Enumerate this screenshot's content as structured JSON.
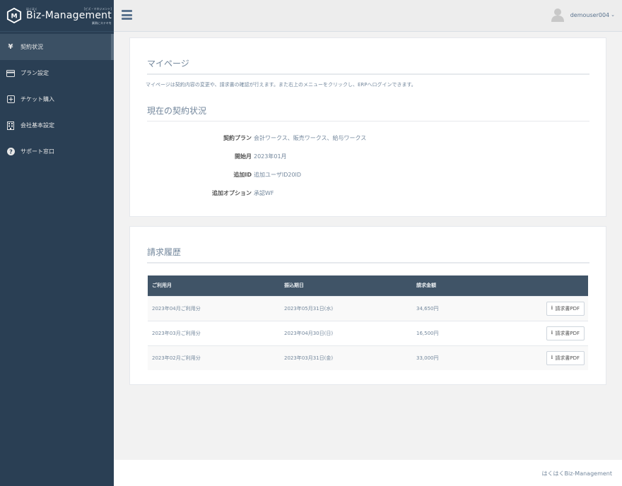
{
  "brand": {
    "sup_left": "はくはく",
    "sup_right": "[ビズ・マネジメント]",
    "name": "Biz-Management",
    "sub": "業務にステキを"
  },
  "sidebar": {
    "items": [
      {
        "icon": "yen-icon",
        "label": "契約状況",
        "active": true
      },
      {
        "icon": "credit-card-icon",
        "label": "プラン設定",
        "active": false
      },
      {
        "icon": "plus-square-icon",
        "label": "チケット購入",
        "active": false
      },
      {
        "icon": "building-icon",
        "label": "会社基本設定",
        "active": false
      },
      {
        "icon": "question-circle-icon",
        "label": "サポート窓口",
        "active": false
      }
    ]
  },
  "topbar": {
    "username": "demouser004",
    "caret": "⌄"
  },
  "mypage": {
    "title": "マイページ",
    "intro": "マイページは契約内容の変更や、請求書の確認が行えます。また右上のメニューをクリックし、ERPへログインできます。",
    "status_title": "現在の契約状況",
    "rows": [
      {
        "key": "契約プラン",
        "value": "会計ワークス、販売ワークス、給与ワークス"
      },
      {
        "key": "開始月",
        "value": "2023年01月"
      },
      {
        "key": "追加ID",
        "value": "追加ユーザID20ID"
      },
      {
        "key": "追加オプション",
        "value": "承認WF"
      }
    ]
  },
  "billing": {
    "title": "請求履歴",
    "headers": [
      "ご利用月",
      "振込期日",
      "請求金額",
      ""
    ],
    "rows": [
      {
        "month": "2023年04月ご利用分",
        "due": "2023年05月31日(水)",
        "amount": "34,650円",
        "button": "請求書PDF"
      },
      {
        "month": "2023年03月ご利用分",
        "due": "2023年04月30日(日)",
        "amount": "16,500円",
        "button": "請求書PDF"
      },
      {
        "month": "2023年02月ご利用分",
        "due": "2023年03月31日(金)",
        "amount": "33,000円",
        "button": "請求書PDF"
      }
    ]
  },
  "footer": {
    "text": "はくはくBiz-Management"
  },
  "colors": {
    "sidebar": "#2a3f54",
    "table_header": "#405467",
    "text_muted": "#73879c"
  }
}
